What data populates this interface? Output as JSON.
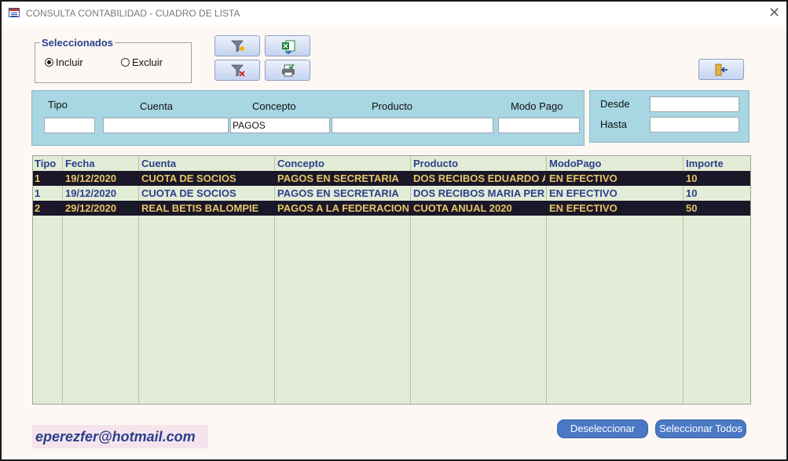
{
  "window": {
    "title": "CONSULTA CONTABILIDAD - CUADRO DE LISTA",
    "close_label": "✕"
  },
  "selection_group": {
    "legend": "Seleccionados",
    "options": [
      {
        "label": "Incluir",
        "checked": true
      },
      {
        "label": "Excluir",
        "checked": false
      }
    ]
  },
  "toolbar": {
    "icons": [
      "filter-icon",
      "excel-export-icon",
      "clear-filter-icon",
      "print-icon",
      "exit-icon"
    ]
  },
  "filters": {
    "tipo": {
      "label": "Tipo",
      "value": ""
    },
    "cuenta": {
      "label": "Cuenta",
      "value": ""
    },
    "concepto": {
      "label": "Concepto",
      "value": "PAGOS"
    },
    "producto": {
      "label": "Producto",
      "value": ""
    },
    "modo_pago": {
      "label": "Modo Pago",
      "value": ""
    }
  },
  "dates": {
    "desde": {
      "label": "Desde",
      "value": ""
    },
    "hasta": {
      "label": "Hasta",
      "value": ""
    }
  },
  "grid": {
    "columns": [
      "Tipo",
      "Fecha",
      "Cuenta",
      "Concepto",
      "Producto",
      "ModoPago",
      "Importe"
    ],
    "rows": [
      {
        "selected": true,
        "cells": [
          "1",
          "19/12/2020",
          "CUOTA DE SOCIOS",
          "PAGOS EN SECRETARIA",
          "DOS RECIBOS EDUARDO ARI",
          "EN EFECTIVO",
          "10"
        ]
      },
      {
        "selected": false,
        "cells": [
          "1",
          "19/12/2020",
          "CUOTA DE SOCIOS",
          "PAGOS EN SECRETARIA",
          "DOS RECIBOS MARIA PEREZ",
          "EN EFECTIVO",
          "10"
        ]
      },
      {
        "selected": true,
        "cells": [
          "2",
          "29/12/2020",
          "REAL BETIS BALOMPIE",
          "PAGOS A LA FEDERACION",
          "CUOTA ANUAL 2020",
          "EN EFECTIVO",
          "50"
        ]
      }
    ]
  },
  "footer": {
    "email": "eperezfer@hotmail.com",
    "deselect_label": "Deseleccionar",
    "select_all_label": "Seleccionar Todos"
  }
}
